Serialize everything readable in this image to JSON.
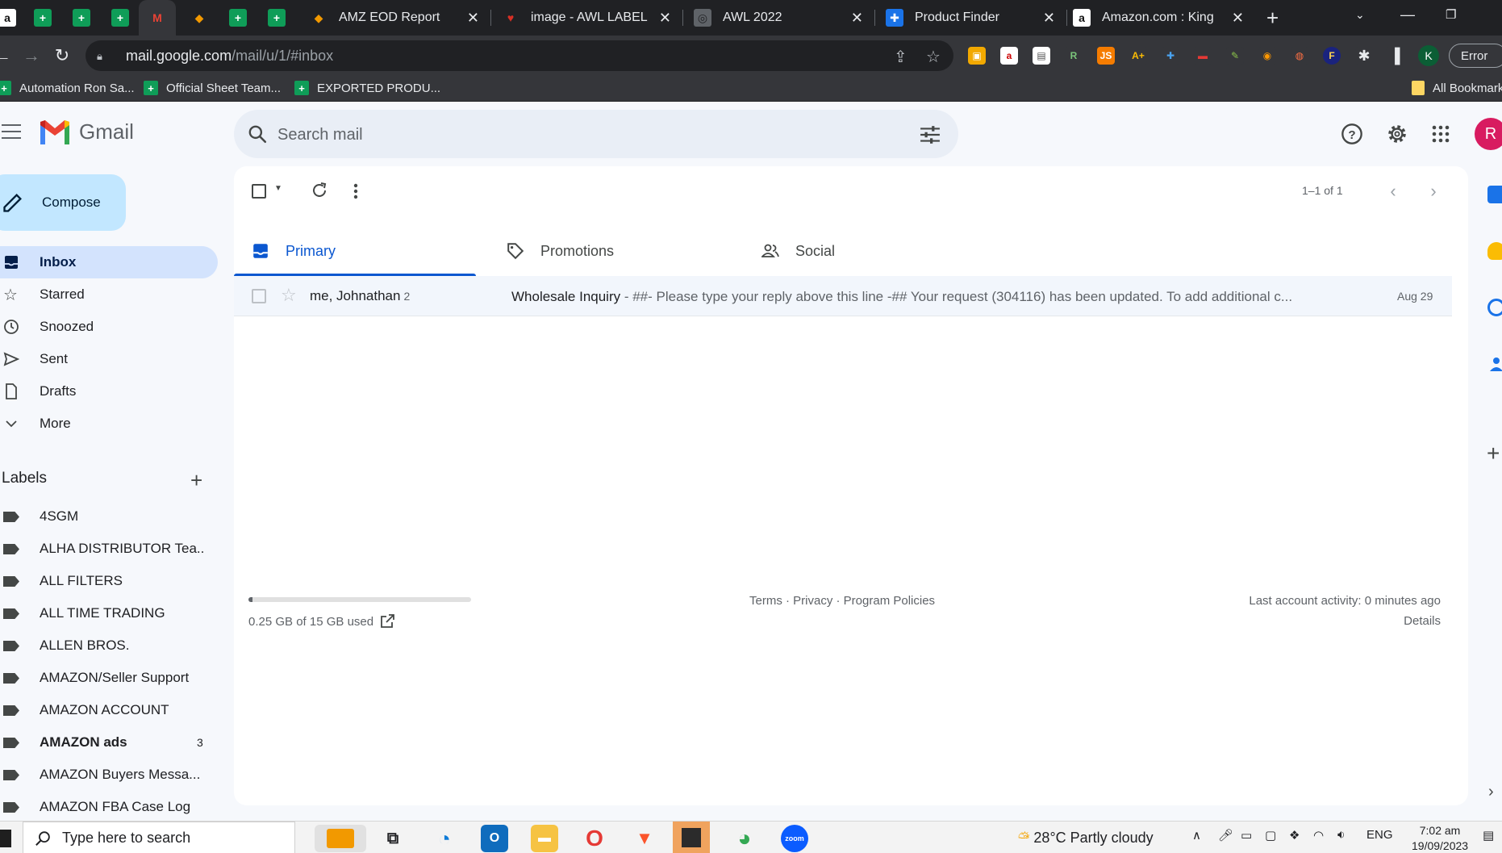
{
  "browser": {
    "tabs": [
      {
        "icon": "sheets-icon",
        "pinned": true
      },
      {
        "icon": "sheets-icon",
        "pinned": true
      },
      {
        "icon": "gmail-icon",
        "pinned": true,
        "active": true
      },
      {
        "icon": "kite-icon",
        "pinned": true
      },
      {
        "icon": "sheets-icon",
        "pinned": true
      },
      {
        "icon": "sheets-icon",
        "pinned": true
      },
      {
        "icon": "kite-icon",
        "title": "AMZ EOD Report"
      },
      {
        "icon": "awl-icon",
        "title": "image - AWL LABEL"
      },
      {
        "icon": "globe-icon",
        "title": "AWL 2022"
      },
      {
        "icon": "product-finder-icon",
        "title": "Product Finder"
      },
      {
        "icon": "amazon-icon",
        "title": "Amazon.com : King Arthur"
      }
    ],
    "url_domain": "mail.google.com",
    "url_path": "/mail/u/1/#inbox",
    "profile_initial": "K",
    "error_label": "Error",
    "bookmarks": [
      {
        "label": "Automation Ron Sa..."
      },
      {
        "label": "Official Sheet Team..."
      },
      {
        "label": "EXPORTED PRODU..."
      }
    ],
    "all_bookmarks_label": "All Bookmarks"
  },
  "gmail": {
    "logo_text": "Gmail",
    "search_placeholder": "Search mail",
    "account_initial": "R",
    "compose_label": "Compose",
    "nav": [
      {
        "label": "Inbox",
        "icon": "inbox-icon",
        "active": true
      },
      {
        "label": "Starred",
        "icon": "star-icon"
      },
      {
        "label": "Snoozed",
        "icon": "clock-icon"
      },
      {
        "label": "Sent",
        "icon": "send-icon"
      },
      {
        "label": "Drafts",
        "icon": "draft-icon"
      },
      {
        "label": "More",
        "icon": "chevron-down-icon"
      }
    ],
    "labels_title": "Labels",
    "labels": [
      {
        "name": "4SGM"
      },
      {
        "name": "ALHA DISTRIBUTOR Tea..."
      },
      {
        "name": "ALL FILTERS"
      },
      {
        "name": "ALL TIME TRADING"
      },
      {
        "name": "ALLEN BROS."
      },
      {
        "name": "AMAZON/Seller Support"
      },
      {
        "name": "AMAZON ACCOUNT"
      },
      {
        "name": "AMAZON ads",
        "count": "3",
        "bold": true
      },
      {
        "name": "AMAZON Buyers Messa..."
      },
      {
        "name": "AMAZON FBA Case Log"
      }
    ],
    "pager": "1–1 of 1",
    "categories": [
      {
        "label": "Primary",
        "icon": "inbox-icon",
        "active": true
      },
      {
        "label": "Promotions",
        "icon": "tag-icon"
      },
      {
        "label": "Social",
        "icon": "people-icon"
      }
    ],
    "emails": [
      {
        "sender": "me, Johnathan",
        "thread_count": "2",
        "subject": "Wholesale Inquiry",
        "preview": " - ##- Please type your reply above this line -## Your request (304116) has been updated. To add additional c...",
        "date": "Aug 29"
      }
    ],
    "storage_text": "0.25 GB of 15 GB used",
    "storage_fraction": 0.017,
    "footer_links": "Terms · Privacy · Program Policies",
    "last_activity": "Last account activity: 0 minutes ago",
    "details_label": "Details"
  },
  "taskbar": {
    "search_placeholder": "Type here to search",
    "weather": "28°C  Partly cloudy",
    "language": "ENG",
    "time": "7:02 am",
    "date": "19/09/2023"
  }
}
